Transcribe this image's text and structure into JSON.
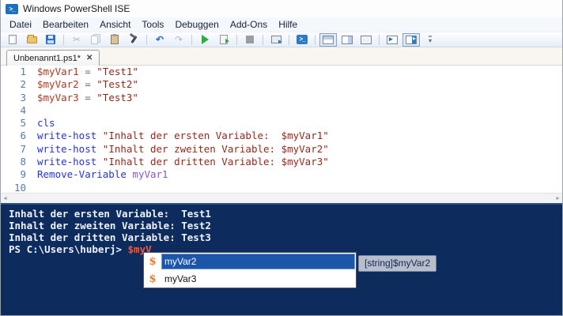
{
  "window": {
    "title": "Windows PowerShell ISE"
  },
  "menu": {
    "items": [
      "Datei",
      "Bearbeiten",
      "Ansicht",
      "Tools",
      "Debuggen",
      "Add-Ons",
      "Hilfe"
    ]
  },
  "toolbar": {
    "buttons": [
      {
        "name": "new-script-button",
        "icon": "new-file-icon",
        "state": "normal"
      },
      {
        "name": "open-script-button",
        "icon": "open-folder-icon",
        "state": "normal"
      },
      {
        "name": "save-script-button",
        "icon": "save-icon",
        "state": "normal"
      },
      {
        "name": "separator"
      },
      {
        "name": "cut-button",
        "icon": "cut-icon",
        "state": "disabled"
      },
      {
        "name": "copy-button",
        "icon": "copy-icon",
        "state": "disabled"
      },
      {
        "name": "paste-button",
        "icon": "paste-icon",
        "state": "normal"
      },
      {
        "name": "clear-console-button",
        "icon": "clear-console-icon",
        "state": "normal"
      },
      {
        "name": "separator"
      },
      {
        "name": "undo-button",
        "icon": "undo-icon",
        "state": "normal"
      },
      {
        "name": "redo-button",
        "icon": "redo-icon",
        "state": "disabled"
      },
      {
        "name": "separator"
      },
      {
        "name": "run-script-button",
        "icon": "run-icon",
        "state": "normal"
      },
      {
        "name": "run-selection-button",
        "icon": "run-selection-icon",
        "state": "normal"
      },
      {
        "name": "separator"
      },
      {
        "name": "stop-operation-button",
        "icon": "stop-icon",
        "state": "disabled"
      },
      {
        "name": "separator"
      },
      {
        "name": "new-remote-tab-button",
        "icon": "remote-tab-icon",
        "state": "normal"
      },
      {
        "name": "separator"
      },
      {
        "name": "start-powershell-button",
        "icon": "powershell-icon",
        "state": "normal"
      },
      {
        "name": "separator"
      },
      {
        "name": "script-pane-top-button",
        "icon": "pane-top-icon",
        "state": "active"
      },
      {
        "name": "script-pane-right-button",
        "icon": "pane-right-icon",
        "state": "normal"
      },
      {
        "name": "script-pane-max-button",
        "icon": "pane-max-icon",
        "state": "normal"
      },
      {
        "name": "separator"
      },
      {
        "name": "show-command-addon-button",
        "icon": "addon-arrow-icon",
        "state": "normal"
      },
      {
        "name": "show-script-pane-button",
        "icon": "script-pane-arrow-icon",
        "state": "active"
      },
      {
        "name": "toolbar-overflow-button",
        "icon": "overflow-chevron-icon",
        "state": "normal"
      }
    ]
  },
  "tabs": [
    {
      "label": "Unbenannt1.ps1*",
      "close_glyph": "✕"
    }
  ],
  "editor": {
    "lines": [
      {
        "n": "1",
        "tokens": [
          {
            "c": "variable",
            "t": "$myVar1"
          },
          {
            "c": "operator",
            "t": " = "
          },
          {
            "c": "string",
            "t": "\"Test1\""
          }
        ]
      },
      {
        "n": "2",
        "tokens": [
          {
            "c": "variable",
            "t": "$myVar2"
          },
          {
            "c": "operator",
            "t": " = "
          },
          {
            "c": "string",
            "t": "\"Test2\""
          }
        ]
      },
      {
        "n": "3",
        "tokens": [
          {
            "c": "variable",
            "t": "$myVar3"
          },
          {
            "c": "operator",
            "t": " = "
          },
          {
            "c": "string",
            "t": "\"Test3\""
          }
        ]
      },
      {
        "n": "4",
        "tokens": []
      },
      {
        "n": "5",
        "tokens": [
          {
            "c": "cmdlet",
            "t": "cls"
          }
        ]
      },
      {
        "n": "6",
        "tokens": [
          {
            "c": "cmdlet",
            "t": "write-host"
          },
          {
            "c": "plain",
            "t": " "
          },
          {
            "c": "string",
            "t": "\"Inhalt der ersten Variable:  $myVar1\""
          }
        ]
      },
      {
        "n": "7",
        "tokens": [
          {
            "c": "cmdlet",
            "t": "write-host"
          },
          {
            "c": "plain",
            "t": " "
          },
          {
            "c": "string",
            "t": "\"Inhalt der zweiten Variable: $myVar2\""
          }
        ]
      },
      {
        "n": "8",
        "tokens": [
          {
            "c": "cmdlet",
            "t": "write-host"
          },
          {
            "c": "plain",
            "t": " "
          },
          {
            "c": "string",
            "t": "\"Inhalt der dritten Variable: $myVar3\""
          }
        ]
      },
      {
        "n": "9",
        "tokens": [
          {
            "c": "cmdlet",
            "t": "Remove-Variable"
          },
          {
            "c": "plain",
            "t": " "
          },
          {
            "c": "argument",
            "t": "myVar1"
          }
        ]
      },
      {
        "n": "10",
        "tokens": []
      }
    ]
  },
  "console": {
    "output_lines": [
      "Inhalt der ersten Variable:  Test1",
      "Inhalt der zweiten Variable: Test2",
      "Inhalt der dritten Variable: Test3"
    ],
    "prompt": "PS C:\\Users\\huberj> ",
    "typed": "$myV"
  },
  "intellisense": {
    "item_icon": "$",
    "items": [
      {
        "label": "myVar2",
        "selected": true
      },
      {
        "label": "myVar3",
        "selected": false
      }
    ],
    "tooltip": "[string]$myVar2"
  },
  "colors": {
    "console_bg": "#0e2b5d",
    "typed_text": "#ef5a3d",
    "selection_blue": "#1d55a8",
    "cmdlet": "#2734cc",
    "variable": "#a63c22",
    "string": "#8e2a1c",
    "argument": "#8a55c8",
    "line_number": "#5b7aa6",
    "tooltip_bg": "#b9bfca"
  }
}
